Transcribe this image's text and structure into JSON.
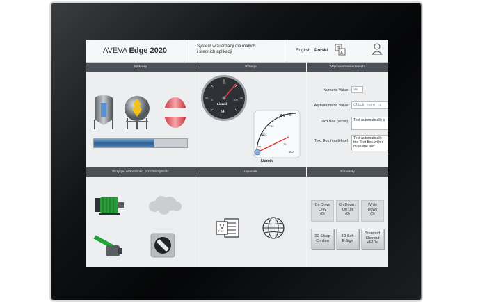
{
  "header": {
    "brand_prefix": "AVEVA",
    "brand_name": "Edge 2020",
    "system_title_line1": "System wizualizacji dla małych",
    "system_title_line2": "i średnich aplikacji",
    "lang_english": "English",
    "lang_polski": "Polski",
    "translate_icon": "translate-icon",
    "user_icon": "user-icon"
  },
  "panels": {
    "wykresy": {
      "title": "Wykresy",
      "progress": 0.64
    },
    "rotacje": {
      "title": "Rotacje",
      "gauge1_label": "Licznik",
      "gauge1_value": "64",
      "gauge2_label": "Licznik",
      "gauge2_value": "64"
    },
    "wprowadzanie": {
      "title": "Wprowadzanie danych",
      "numeric_label": "Numeric Value:",
      "numeric_value": "30",
      "alpha_label": "Alphanumeric Value:",
      "alpha_placeholder": "Click here to",
      "textbox_scroll_label": "Text Box (scroll):",
      "textbox_scroll_value": "Text automatically s",
      "textbox_multi_label": "Text Box (multi-line):",
      "textbox_multi_value": "Text automatically the Text Box with s multi-line text"
    },
    "pozycja": {
      "title": "Pozycja, widoczność, przeźroczystość"
    },
    "hiperlink": {
      "title": "Hiperlink"
    },
    "komendy": {
      "title": "Komendy",
      "buttons": [
        {
          "line1": "On Down",
          "line2": "Only",
          "line3": "(0)"
        },
        {
          "line1": "On Down /",
          "line2": "On Up",
          "line3": "(0)"
        },
        {
          "line1": "While",
          "line2": "Down",
          "line3": "(0)"
        },
        {
          "line1": "3D Sharp",
          "line2": "Confirm",
          "line3": ""
        },
        {
          "line1": "3D Soft",
          "line2": "E-Sign",
          "line3": ""
        },
        {
          "line1": "Standard",
          "line2": "Shortcut",
          "line3": "<F10>"
        }
      ]
    }
  },
  "colors": {
    "accent": "#3a73a8",
    "header": "#4b5156"
  }
}
